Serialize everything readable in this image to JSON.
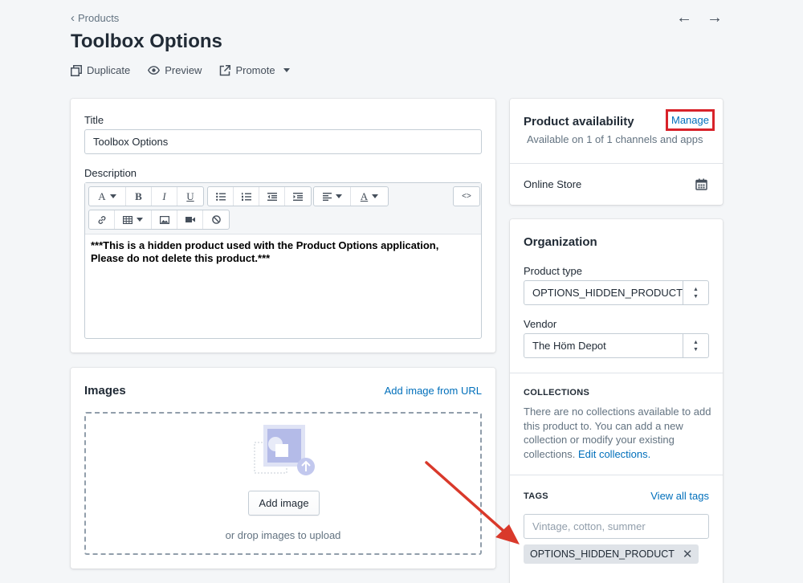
{
  "header": {
    "breadcrumb": "Products",
    "title": "Toolbox Options",
    "actions": {
      "duplicate": "Duplicate",
      "preview": "Preview",
      "promote": "Promote"
    }
  },
  "product_card": {
    "title_label": "Title",
    "title_value": "Toolbox Options",
    "description_label": "Description",
    "description_text": "***This is a hidden product used with the Product Options application, Please do not delete this product.***",
    "toolbar": {
      "font_glyph": "A",
      "bold_glyph": "B",
      "italic_glyph": "I",
      "underline_glyph": "U",
      "color_glyph": "A",
      "html_glyph": "<>"
    }
  },
  "images_card": {
    "heading": "Images",
    "add_from_url": "Add image from URL",
    "add_button": "Add image",
    "drop_hint": "or drop images to upload"
  },
  "availability_card": {
    "heading": "Product availability",
    "manage_link": "Manage",
    "subtext": "Available on 1 of 1 channels and apps",
    "channel": "Online Store"
  },
  "organization_card": {
    "heading": "Organization",
    "product_type_label": "Product type",
    "product_type_value": "OPTIONS_HIDDEN_PRODUCT",
    "vendor_label": "Vendor",
    "vendor_value": "The Höm Depot",
    "collections_heading": "COLLECTIONS",
    "collections_text": "There are no collections available to add this product to. You can add a new collection or modify your existing collections.",
    "edit_collections_link": "Edit collections.",
    "tags_heading": "TAGS",
    "view_all_tags": "View all tags",
    "tags_placeholder": "Vintage, cotton, summer",
    "tags": [
      "OPTIONS_HIDDEN_PRODUCT"
    ]
  },
  "colors": {
    "link": "#006fbb",
    "highlight": "#d8232a",
    "arrow": "#d9392b"
  }
}
